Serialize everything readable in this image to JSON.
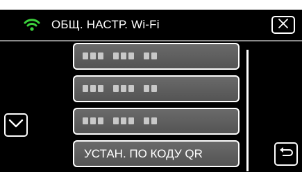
{
  "header": {
    "title": "ОБЩ. НАСТР. Wi-Fi",
    "wifi_icon": "wifi-icon",
    "close_icon": "close-icon",
    "wifi_color": "#3cd23c"
  },
  "list": {
    "items": [
      {
        "label": "",
        "masked": true
      },
      {
        "label": "",
        "masked": true
      },
      {
        "label": "",
        "masked": true
      },
      {
        "label": "УСТАН. ПО КОДУ QR",
        "masked": false
      }
    ]
  },
  "navigation": {
    "down_icon": "chevron-down-icon",
    "back_icon": "back-arrow-icon"
  }
}
